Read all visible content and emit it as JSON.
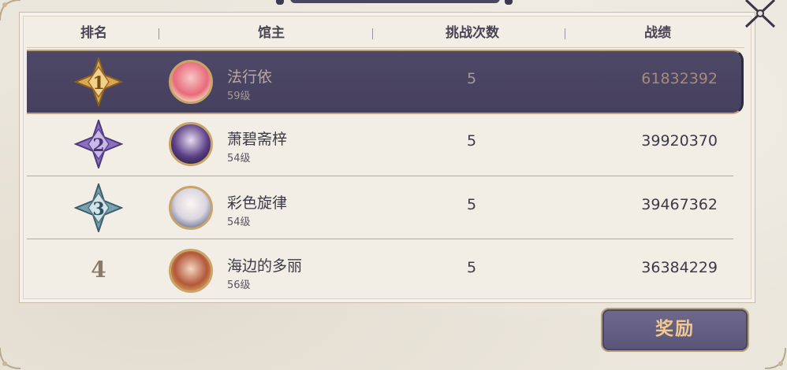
{
  "header": {
    "rank_label": "排名",
    "owner_label": "馆主",
    "challenges_label": "挑战次数",
    "record_label": "战绩"
  },
  "rows": [
    {
      "rank": "1",
      "name": "法行依",
      "level": "59级",
      "challenges": "5",
      "record": "61832392"
    },
    {
      "rank": "2",
      "name": "萧碧斋梓",
      "level": "54级",
      "challenges": "5",
      "record": "39920370"
    },
    {
      "rank": "3",
      "name": "彩色旋律",
      "level": "54级",
      "challenges": "5",
      "record": "39467362"
    },
    {
      "rank": "4",
      "name": "海边的多丽",
      "level": "56级",
      "challenges": "5",
      "record": "36384229"
    }
  ],
  "reward_button": "奖励",
  "colors": {
    "selected_row": "#4e4868",
    "gold": "#c8a46a",
    "button_text": "#f1c98c"
  }
}
